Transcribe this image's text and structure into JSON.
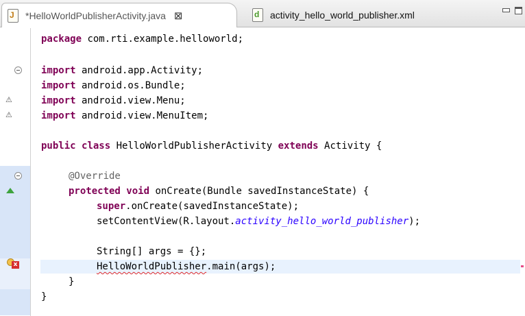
{
  "tabs": [
    {
      "label": "*HelloWorldPublisherActivity.java",
      "icon": "java-file-icon",
      "close": "⊠"
    },
    {
      "label": "activity_hello_world_publisher.xml",
      "icon": "xml-file-icon"
    }
  ],
  "code": {
    "l1_kw": "package",
    "l1_rest": " com.rti.example.helloworld;",
    "l2_kw": "import",
    "l2_rest": " android.app.Activity;",
    "l3_kw": "import",
    "l3_rest": " android.os.Bundle;",
    "l4_kw": "import",
    "l4_rest": " android.view.Menu;",
    "l5_kw": "import",
    "l5_rest": " android.view.MenuItem;",
    "l6_kw1": "public",
    "l6_kw2": "class",
    "l6_name": " HelloWorldPublisherActivity ",
    "l6_kw3": "extends",
    "l6_rest": " Activity {",
    "l7_ann": "@Override",
    "l8_kw1": "protected",
    "l8_kw2": "void",
    "l8_rest": " onCreate(Bundle savedInstanceState) {",
    "l9_kw": "super",
    "l9_rest": ".onCreate(savedInstanceState);",
    "l10_a": "setContentView(R.layout.",
    "l10_b": "activity_hello_world_publisher",
    "l10_c": ");",
    "l11": "String[] args = {};",
    "l12_err": "HelloWorldPublisher",
    "l12_rest": ".main(args);",
    "l13": "}",
    "l14": "}"
  },
  "colors": {
    "keyword": "#7f0055",
    "annotation": "#646464",
    "static_field": "#2a00ff",
    "error_underline": "#e0282a",
    "current_line": "#e8f2fe"
  }
}
